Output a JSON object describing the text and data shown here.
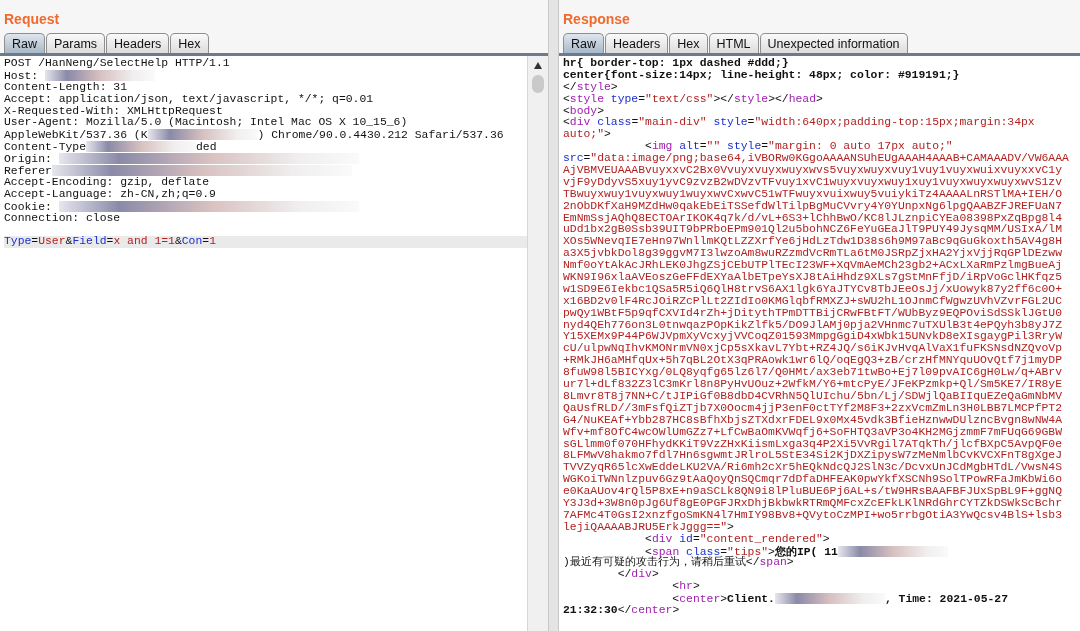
{
  "request": {
    "title": "Request",
    "tabs": [
      {
        "label": "Raw",
        "selected": true
      },
      {
        "label": "Params",
        "selected": false
      },
      {
        "label": "Headers",
        "selected": false
      },
      {
        "label": "Hex",
        "selected": false
      }
    ],
    "lines": [
      {
        "highlighted": false,
        "segments": [
          {
            "kind": "plain",
            "t": "POST /HanNeng/SelectHelp HTTP/1.1"
          }
        ]
      },
      {
        "highlighted": false,
        "segments": [
          {
            "kind": "plain",
            "t": "Host: "
          },
          {
            "kind": "redacted"
          }
        ]
      },
      {
        "highlighted": false,
        "segments": [
          {
            "kind": "plain",
            "t": "Content-Length: 31"
          }
        ]
      },
      {
        "highlighted": false,
        "segments": [
          {
            "kind": "plain",
            "t": "Accept: application/json, text/javascript, */*; q=0.01"
          }
        ]
      },
      {
        "highlighted": false,
        "segments": [
          {
            "kind": "plain",
            "t": "X-Requested-With: XMLHttpRequest"
          }
        ]
      },
      {
        "highlighted": false,
        "segments": [
          {
            "kind": "plain",
            "t": "User-Agent: Mozilla/5.0 (Macintosh; Intel Mac OS X 10_15_6)"
          }
        ]
      },
      {
        "highlighted": false,
        "segments": [
          {
            "kind": "plain",
            "t": "AppleWebKit/537.36 (K"
          },
          {
            "kind": "redacted"
          },
          {
            "kind": "plain",
            "t": ") Chrome/90.0.4430.212 Safari/537.36"
          }
        ]
      },
      {
        "highlighted": false,
        "segments": [
          {
            "kind": "plain",
            "t": "Content-Type"
          },
          {
            "kind": "redacted"
          },
          {
            "kind": "plain",
            "t": "ded"
          }
        ]
      },
      {
        "highlighted": false,
        "segments": [
          {
            "kind": "plain",
            "t": "Origin: "
          },
          {
            "kind": "redactedwide"
          }
        ]
      },
      {
        "highlighted": false,
        "segments": [
          {
            "kind": "plain",
            "t": "Referer"
          },
          {
            "kind": "redactedwide"
          }
        ]
      },
      {
        "highlighted": false,
        "segments": [
          {
            "kind": "plain",
            "t": "Accept-Encoding: gzip, deflate"
          }
        ]
      },
      {
        "highlighted": false,
        "segments": [
          {
            "kind": "plain",
            "t": "Accept-Language: zh-CN,zh;q=0.9"
          }
        ]
      },
      {
        "highlighted": false,
        "segments": [
          {
            "kind": "plain",
            "t": "Cookie: "
          },
          {
            "kind": "redactedwide"
          }
        ]
      },
      {
        "highlighted": false,
        "segments": [
          {
            "kind": "plain",
            "t": "Connection: close"
          }
        ]
      },
      {
        "highlighted": false
      },
      {
        "highlighted": true,
        "segments": [
          {
            "kind": "attr",
            "t": "Type"
          },
          {
            "kind": "plain",
            "t": "="
          },
          {
            "kind": "str",
            "t": "User"
          },
          {
            "kind": "plain",
            "t": "&"
          },
          {
            "kind": "attr",
            "t": "Field"
          },
          {
            "kind": "plain",
            "t": "="
          },
          {
            "kind": "str",
            "t": "x and 1=1"
          },
          {
            "kind": "plain",
            "t": "&"
          },
          {
            "kind": "attr",
            "t": "Con"
          },
          {
            "kind": "plain",
            "t": "="
          },
          {
            "kind": "str",
            "t": "1"
          }
        ]
      }
    ]
  },
  "response": {
    "title": "Response",
    "tabs": [
      {
        "label": "Raw",
        "selected": true
      },
      {
        "label": "Headers",
        "selected": false
      },
      {
        "label": "Hex",
        "selected": false
      },
      {
        "label": "HTML",
        "selected": false
      },
      {
        "label": "Unexpected information",
        "selected": false
      }
    ],
    "lines": [
      {
        "highlighted": false,
        "segments": [
          {
            "kind": "bold",
            "t": "hr{ border-top: 1px dashed #ddd;}"
          }
        ]
      },
      {
        "highlighted": false,
        "segments": [
          {
            "kind": "bold",
            "t": "center{font-size:14px; line-height: 48px; color: #919191;}"
          }
        ]
      },
      {
        "highlighted": false,
        "segments": [
          {
            "kind": "plain",
            "t": "</"
          },
          {
            "kind": "tag",
            "t": "style"
          },
          {
            "kind": "plain",
            "t": ">"
          }
        ]
      },
      {
        "highlighted": false,
        "segments": [
          {
            "kind": "plain",
            "t": "<"
          },
          {
            "kind": "tag",
            "t": "style"
          },
          {
            "kind": "attr",
            "t": " type"
          },
          {
            "kind": "plain",
            "t": "="
          },
          {
            "kind": "str",
            "t": "\"text/css\""
          },
          {
            "kind": "plain",
            "t": "></"
          },
          {
            "kind": "tag",
            "t": "style"
          },
          {
            "kind": "plain",
            "t": "></"
          },
          {
            "kind": "tag",
            "t": "head"
          },
          {
            "kind": "plain",
            "t": ">"
          }
        ]
      },
      {
        "highlighted": false,
        "segments": [
          {
            "kind": "plain",
            "t": "<"
          },
          {
            "kind": "tag",
            "t": "body"
          },
          {
            "kind": "plain",
            "t": ">"
          }
        ]
      },
      {
        "highlighted": false,
        "segments": [
          {
            "kind": "plain",
            "t": "<"
          },
          {
            "kind": "tag",
            "t": "div"
          },
          {
            "kind": "attr",
            "t": " class"
          },
          {
            "kind": "plain",
            "t": "="
          },
          {
            "kind": "str",
            "t": "\"main-div\""
          },
          {
            "kind": "attr",
            "t": " style"
          },
          {
            "kind": "plain",
            "t": "="
          },
          {
            "kind": "str",
            "t": "\"width:640px;padding-top:15px;margin:34px"
          }
        ]
      },
      {
        "highlighted": false,
        "segments": [
          {
            "kind": "str",
            "t": "auto;\""
          },
          {
            "kind": "plain",
            "t": ">"
          }
        ]
      },
      {
        "highlighted": false,
        "segments": [
          {
            "kind": "plain",
            "t": "            <"
          },
          {
            "kind": "tag",
            "t": "img"
          },
          {
            "kind": "attr",
            "t": " alt"
          },
          {
            "kind": "plain",
            "t": "="
          },
          {
            "kind": "str",
            "t": "\"\""
          },
          {
            "kind": "attr",
            "t": " style"
          },
          {
            "kind": "plain",
            "t": "="
          },
          {
            "kind": "str",
            "t": "\"margin: 0 auto 17px auto;\""
          }
        ]
      },
      {
        "highlighted": false,
        "segments": [
          {
            "kind": "attr",
            "t": "src"
          },
          {
            "kind": "plain",
            "t": "="
          },
          {
            "kind": "str",
            "t": "\"data:image/png;base64,iVBORw0KGgoAAAANSUhEUgAAAH4AAAB+CAMAAADV/VW6AAA"
          }
        ]
      },
      {
        "highlighted": false,
        "segments": [
          {
            "kind": "str",
            "t": "AjVBMVEUAAABvuyxxvC2Bx0Vvuyxvuyxwuyxwvs5vuyxwuyxvuy1vuy1vuyxwuixvuyxxvC1y"
          }
        ]
      },
      {
        "highlighted": false,
        "segments": [
          {
            "kind": "str",
            "t": "vjF9yDdyvS5xuy1yvC9zvzB2wDVzvTFvuy1xvC1wuyxvuyxwuy1xuy1vuyxwuyxwuyxwvS1zv"
          }
        ]
      },
      {
        "highlighted": false,
        "segments": [
          {
            "kind": "str",
            "t": "TBwuyxwuy1vuyxwuy1wuyxwvCxwvC51wTFwuyxvuixwuy5vuiykiTz4AAAALnRSTlMA+IEH/O"
          }
        ]
      },
      {
        "highlighted": false,
        "segments": [
          {
            "kind": "str",
            "t": "2nObDKfXaH9MZdHw0qakEbEiTSSefdWlTilpBgMuCVvry4Y0YUnpxNg6lpgQAABZFJREFUaN7"
          }
        ]
      },
      {
        "highlighted": false,
        "segments": [
          {
            "kind": "str",
            "t": "EmNmSsjAQhQ8ECTOArIKOK4q7k/d/vL+6S3+lChhBwO/KC8lJLznpiCYEa08398PxZqBpg8l4"
          }
        ]
      },
      {
        "highlighted": false,
        "segments": [
          {
            "kind": "str",
            "t": "uDd1bx2gB0Ssb39UIT9bPRboEPm901Ql2u5bohNCZ6FeYuGEaJlT9PUY49JysqMM/USIxA/lM"
          }
        ]
      },
      {
        "highlighted": false,
        "segments": [
          {
            "kind": "str",
            "t": "XOs5WNevqIE7eHn97WnllmKQtLZZXrfYe6jHdLzTdw1D38s6h9M97aBc9qGuGkoxth5AV4g8H"
          }
        ]
      },
      {
        "highlighted": false,
        "segments": [
          {
            "kind": "str",
            "t": "a3X5jvbkDol8g39ggvM7I3lwzoAm8wuRZzmdVcRmTLa6tM0JSRpZjxHA2YjxVjjRqGPlDEzww"
          }
        ]
      },
      {
        "highlighted": false,
        "segments": [
          {
            "kind": "str",
            "t": "Nmf0oYtAkAcJRhLEK0JhgZSjCEbUTPlTEcI23WF+XqVmAeMCh23gb2+ACxLXaRmPzlmgBueAj"
          }
        ]
      },
      {
        "highlighted": false,
        "segments": [
          {
            "kind": "str",
            "t": "WKN9I96xlaAVEoszGeFFdEXYaAlbETpeYsXJ8tAiHhdz9XLs7gStMnFfjD/iRpVoGclHKfqz5"
          }
        ]
      },
      {
        "highlighted": false,
        "segments": [
          {
            "kind": "str",
            "t": "w1SD9E6Iekbc1QSa5R5iQ6QlH8trvS6AX1lgk6YaJTYCv8TbJEeOsJj/xUowyk87y2ff6c0O+"
          }
        ]
      },
      {
        "highlighted": false,
        "segments": [
          {
            "kind": "str",
            "t": "x16BD2v0lF4RcJOiRZcPlLt2ZIdIo0KMGlqbfRMXZJ+sWU2hL1OJnmCfWgwzUVhVZvrFGL2UC"
          }
        ]
      },
      {
        "highlighted": false,
        "segments": [
          {
            "kind": "str",
            "t": "pwQy1WBtF5p9qfCXVId4rZh+jDitythTPmDTTBijCRwFBtFT/WUbByz9EQPOviSdSSklJGtU0"
          }
        ]
      },
      {
        "highlighted": false,
        "segments": [
          {
            "kind": "str",
            "t": "nyd4QEh776on3L0tnwqazPOpKikZlfk5/DO9JlAMj0pja2VHnmc7uTXUlB3t4ePQyh3b8yJ7Z"
          }
        ]
      },
      {
        "highlighted": false,
        "segments": [
          {
            "kind": "str",
            "t": "Y15XEMx9P44P6WJVpmXyVcxyjVVCoqZ01593MmpgGgiD4xWbk15UNvkD8eXIsgaygPil3RryW"
          }
        ]
      },
      {
        "highlighted": false,
        "segments": [
          {
            "kind": "str",
            "t": "cU/ulpwNqIhvKMONrmVN0xjCp5sXkavL7Ybt+RZ4JQ/s6iKJvHvqAlVaX1fuFKSNsdNZQvoVp"
          }
        ]
      },
      {
        "highlighted": false,
        "segments": [
          {
            "kind": "str",
            "t": "+RMkJH6aMHfqUx+5h7qBL2OtX3qPRAowk1wr6lQ/oqEgQ3+zB/crzHfMNYquUOvQtf7j1myDP"
          }
        ]
      },
      {
        "highlighted": false,
        "segments": [
          {
            "kind": "str",
            "t": "8fuW98l5BICYxg/0LQ8yqfg65lz6l7/Q0HMt/ax3eb71twBo+Ej7l09pvAIC6gH0Lw/q+ABrv"
          }
        ]
      },
      {
        "highlighted": false,
        "segments": [
          {
            "kind": "str",
            "t": "ur7l+dLf832Z3lC3mKrl8n8PyHvUOuz+2WfkM/Y6+mtcPyE/JFeKPzmkp+Ql/Sm5KE7/IR8yE"
          }
        ]
      },
      {
        "highlighted": false,
        "segments": [
          {
            "kind": "str",
            "t": "8Lmvr8T8j7NN+C/tJIPiGf0B8dbD4CVRhN5QlUIchu/5bn/Lj/SDWjlQaBIIquEZeQaGmNbMV"
          }
        ]
      },
      {
        "highlighted": false,
        "segments": [
          {
            "kind": "str",
            "t": "QaUsfRLD//3mFsfQiZTjb7X0Oocm4jjP3enF0ctTYf2M8F3+2zxVcmZmLn3H0LBB7LMCPfPT2"
          }
        ]
      },
      {
        "highlighted": false,
        "segments": [
          {
            "kind": "str",
            "t": "G4/NuKEAf+Ybb287HC8sBfhXbjsZTXdxrFDEL9x0Mx45vdk3BfieHznwwDUlzncBvgn8wNW4A"
          }
        ]
      },
      {
        "highlighted": false,
        "segments": [
          {
            "kind": "str",
            "t": "Wfv+mf8OfC4wcOWlUmGZz7+LfCwBaOmKVWqfj6+SoFHTQ3aVP3o4KH2MGjzmmF7mFUqG69GBW"
          }
        ]
      },
      {
        "highlighted": false,
        "segments": [
          {
            "kind": "str",
            "t": "sGLlmm0f070HFhydKKiT9VzZHxKiismLxga3q4P2Xi5VvRgil7ATqkTh/jlcfBXpC5AvpQF0e"
          }
        ]
      },
      {
        "highlighted": false,
        "segments": [
          {
            "kind": "str",
            "t": "8LFMwV8hakmo7fdl7Hn6sgwmtJRlroL5StE34Si2KjDXZipysW7zMeNmlbCvKVCXFnT8gXgeJ"
          }
        ]
      },
      {
        "highlighted": false,
        "segments": [
          {
            "kind": "str",
            "t": "TVVZyqR65lcXwEddeLKU2VA/Ri6mh2cXr5hEQkNdcQJ2SlN3c/DcvxUnJCdMgbHTdL/VwsN4S"
          }
        ]
      },
      {
        "highlighted": false,
        "segments": [
          {
            "kind": "str",
            "t": "WGKoiTWNnlzpuv6Gz9tAaQoyQnSQCmqr7dDfaDHFEAK0pwYkfXSCNh9SolTPowRFaJmKbWi6o"
          }
        ]
      },
      {
        "highlighted": false,
        "segments": [
          {
            "kind": "str",
            "t": "e0KaAUov4rQl5P8xE+n9aSCLk8QN9i8lPluBUE6Pj6AL+s/tW9HRsBAAFBFJUxSpBL9F+ggNQ"
          }
        ]
      },
      {
        "highlighted": false,
        "segments": [
          {
            "kind": "str",
            "t": "Y3J3d+3W8n0pJg6Uf8gE0PGFJRxDhjBkbwkRTRmQMFcxZcEFkLKlNRdGhrCYTZkDSWkScBchr"
          }
        ]
      },
      {
        "highlighted": false,
        "segments": [
          {
            "kind": "str",
            "t": "7AFMc4T0GsI2xnzfgoSmKN4l7HmIY98Bv8+QVytoCzMPI+wo5rrbgOtiA3YwQcsv4BlS+lsb3"
          }
        ]
      },
      {
        "highlighted": false,
        "segments": [
          {
            "kind": "str",
            "t": "lejiQAAAABJRU5ErkJggg==\""
          },
          {
            "kind": "plain",
            "t": ">"
          }
        ]
      },
      {
        "highlighted": false,
        "segments": [
          {
            "kind": "plain",
            "t": "            <"
          },
          {
            "kind": "tag",
            "t": "div"
          },
          {
            "kind": "attr",
            "t": " id"
          },
          {
            "kind": "plain",
            "t": "="
          },
          {
            "kind": "str",
            "t": "\"content_rendered\""
          },
          {
            "kind": "plain",
            "t": ">"
          }
        ]
      },
      {
        "highlighted": false,
        "segments": [
          {
            "kind": "plain",
            "t": "            <"
          },
          {
            "kind": "tag",
            "t": "span"
          },
          {
            "kind": "attr",
            "t": " class"
          },
          {
            "kind": "plain",
            "t": "="
          },
          {
            "kind": "str",
            "t": "\"tips\""
          },
          {
            "kind": "plain",
            "t": ">"
          },
          {
            "kind": "bold",
            "t": "您的IP( 11"
          },
          {
            "kind": "redacted"
          }
        ]
      },
      {
        "highlighted": false,
        "segments": [
          {
            "kind": "plain",
            "t": ")最近有可疑的攻击行为，请稍后重试</"
          },
          {
            "kind": "tag",
            "t": "span"
          },
          {
            "kind": "plain",
            "t": ">"
          }
        ]
      },
      {
        "highlighted": false,
        "segments": [
          {
            "kind": "plain",
            "t": "        </"
          },
          {
            "kind": "tag",
            "t": "div"
          },
          {
            "kind": "plain",
            "t": ">"
          }
        ]
      },
      {
        "highlighted": false,
        "segments": [
          {
            "kind": "plain",
            "t": "                <"
          },
          {
            "kind": "tag",
            "t": "hr"
          },
          {
            "kind": "plain",
            "t": ">"
          }
        ]
      },
      {
        "highlighted": false,
        "segments": [
          {
            "kind": "plain",
            "t": "                <"
          },
          {
            "kind": "tag",
            "t": "center"
          },
          {
            "kind": "plain",
            "t": ">"
          },
          {
            "kind": "bold",
            "t": "Client."
          },
          {
            "kind": "redacted"
          },
          {
            "kind": "bold",
            "t": ", Time: 2021-05-27"
          }
        ]
      },
      {
        "highlighted": false,
        "segments": [
          {
            "kind": "bold",
            "t": "21:32:30"
          },
          {
            "kind": "plain",
            "t": "</"
          },
          {
            "kind": "tag",
            "t": "center"
          },
          {
            "kind": "plain",
            "t": ">"
          }
        ]
      }
    ]
  }
}
